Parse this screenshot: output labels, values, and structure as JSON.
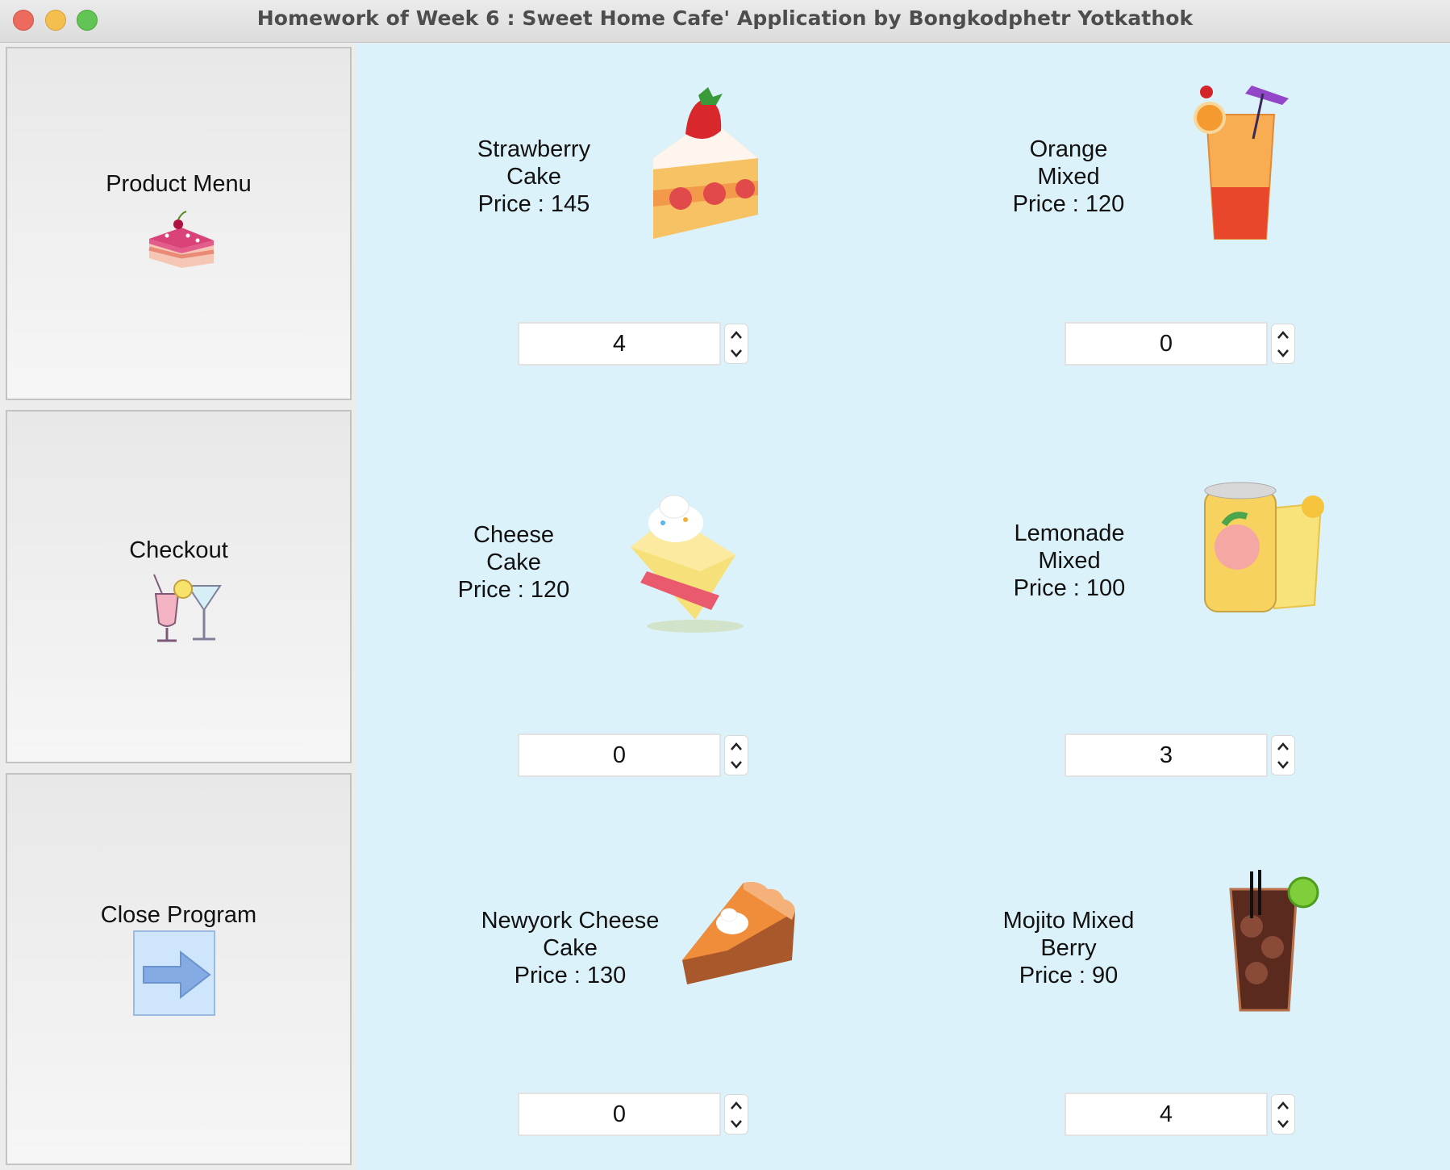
{
  "window": {
    "title": "Homework of Week 6 : Sweet Home Cafe' Application by Bongkodphetr Yotkathok"
  },
  "sidebar": {
    "items": [
      {
        "label": "Product Menu",
        "icon": "cake-icon"
      },
      {
        "label": "Checkout",
        "icon": "cocktail-icon"
      },
      {
        "label": "Close Program",
        "icon": "arrow-right-icon"
      }
    ]
  },
  "products": [
    {
      "name": "Strawberry Cake",
      "price": "Price : 145",
      "qty": "4",
      "icon": "strawberry-cake-icon"
    },
    {
      "name": "Orange Mixed",
      "price": "Price : 120",
      "qty": "0",
      "icon": "orange-drink-icon"
    },
    {
      "name": "Cheese Cake",
      "price": "Price : 120",
      "qty": "0",
      "icon": "cheese-cake-icon"
    },
    {
      "name": "Lemonade Mixed",
      "price": "Price : 100",
      "qty": "3",
      "icon": "lemonade-icon"
    },
    {
      "name": "Newyork Cheese Cake",
      "price": "Price : 130",
      "qty": "0",
      "icon": "pie-icon"
    },
    {
      "name": "Mojito Mixed Berry",
      "price": "Price : 90",
      "qty": "4",
      "icon": "mojito-icon"
    }
  ],
  "colors": {
    "content_background": "#dcf2fa",
    "sidebar_background": "#efefef"
  }
}
